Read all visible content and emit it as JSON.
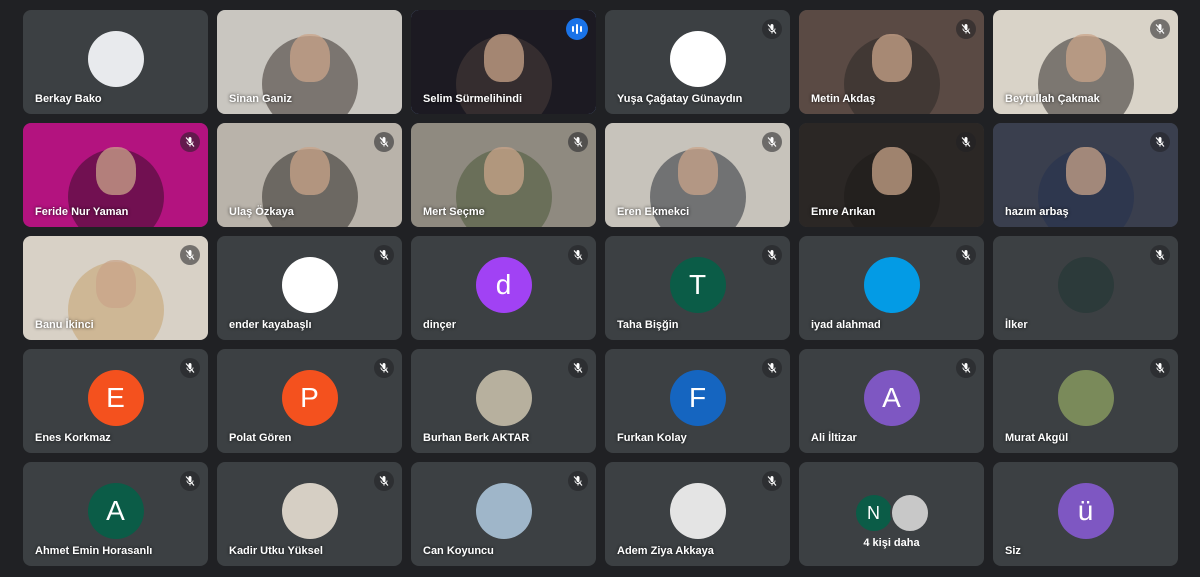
{
  "participants": [
    {
      "name": "Berkay Bako",
      "kind": "photo-avatar",
      "bg": "#e8eaed",
      "muted": false
    },
    {
      "name": "Sinan Ganiz",
      "kind": "video",
      "bg": "#c9c6c0",
      "person": "#3a332d",
      "muted": false
    },
    {
      "name": "Selim Sürmelihindi",
      "kind": "video",
      "bg": "#1c1a22",
      "person": "#4a3e3a",
      "muted": false,
      "speaking": true
    },
    {
      "name": "Yuşa Çağatay Günaydın",
      "kind": "photo-avatar",
      "bg": "#ffffff",
      "muted": true
    },
    {
      "name": "Metin Akdaş",
      "kind": "video",
      "bg": "#5a4a44",
      "person": "#2e2a28",
      "muted": true
    },
    {
      "name": "Beytullah Çakmak",
      "kind": "video",
      "bg": "#d9d3c8",
      "person": "#2f2b29",
      "muted": true
    },
    {
      "name": "Feride Nur Yaman",
      "kind": "video",
      "bg": "#b3137f",
      "person": "#3a0f2c",
      "muted": true
    },
    {
      "name": "Ulaş Özkaya",
      "kind": "video",
      "bg": "#b9b3aa",
      "person": "#2e2a27",
      "muted": true
    },
    {
      "name": "Mert Seçme",
      "kind": "video",
      "bg": "#8f8a80",
      "person": "#4c5a38",
      "muted": true
    },
    {
      "name": "Eren Ekmekci",
      "kind": "video",
      "bg": "#c7c3bb",
      "person": "#2a2f38",
      "muted": true
    },
    {
      "name": "Emre Arıkan",
      "kind": "video",
      "bg": "#2b2725",
      "person": "#1d1b1a",
      "muted": true
    },
    {
      "name": "hazım arbaş",
      "kind": "video",
      "bg": "#3a3f4e",
      "person": "#25324f",
      "muted": true
    },
    {
      "name": "Banu İkinci",
      "kind": "video",
      "bg": "#d8d1c6",
      "person": "#c7a26e",
      "muted": true
    },
    {
      "name": "ender kayabaşlı",
      "kind": "photo-avatar",
      "bg": "#ffffff",
      "muted": true
    },
    {
      "name": "dinçer",
      "kind": "letter",
      "letter": "d",
      "color": "#a142f4",
      "muted": true
    },
    {
      "name": "Taha Bişğin",
      "kind": "letter",
      "letter": "T",
      "color": "#0b5c47",
      "muted": true
    },
    {
      "name": "iyad alahmad",
      "kind": "letter",
      "letter": "",
      "color": "#039be5",
      "muted": true
    },
    {
      "name": "İlker",
      "kind": "photo-avatar",
      "bg": "#2c3a3a",
      "muted": true
    },
    {
      "name": "Enes Korkmaz",
      "kind": "letter",
      "letter": "E",
      "color": "#f4511e",
      "muted": true
    },
    {
      "name": "Polat Gören",
      "kind": "letter",
      "letter": "P",
      "color": "#f4511e",
      "muted": true
    },
    {
      "name": "Burhan Berk AKTAR",
      "kind": "photo-avatar",
      "bg": "#b7b09e",
      "muted": true
    },
    {
      "name": "Furkan Kolay",
      "kind": "letter",
      "letter": "F",
      "color": "#1565c0",
      "muted": true
    },
    {
      "name": "Ali İltizar",
      "kind": "letter",
      "letter": "A",
      "color": "#7e57c2",
      "muted": true
    },
    {
      "name": "Murat Akgül",
      "kind": "photo-avatar",
      "bg": "#7a8a5a",
      "muted": true
    },
    {
      "name": "Ahmet Emin Horasanlı",
      "kind": "letter",
      "letter": "A",
      "color": "#0b5c47",
      "muted": true
    },
    {
      "name": "Kadir Utku Yüksel",
      "kind": "photo-avatar",
      "bg": "#d6cfc4",
      "muted": true
    },
    {
      "name": "Can Koyuncu",
      "kind": "photo-avatar",
      "bg": "#9fb6c9",
      "muted": true
    },
    {
      "name": "Adem Ziya Akkaya",
      "kind": "photo-avatar",
      "bg": "#e4e4e4",
      "muted": true
    },
    {
      "name": "",
      "kind": "more",
      "more_label": "4 kişi daha",
      "letter": "N",
      "color": "#0b5c47",
      "photo_bg": "#c8c8c8",
      "muted": false
    },
    {
      "name": "Siz",
      "kind": "letter",
      "letter": "ü",
      "color": "#7e57c2",
      "muted": false
    }
  ]
}
